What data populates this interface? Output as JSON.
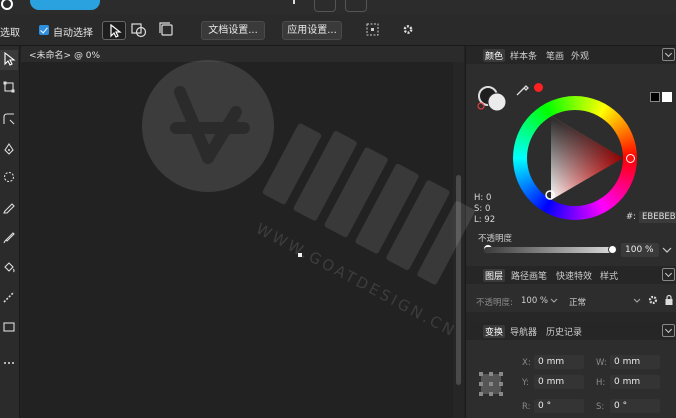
{
  "toolbar": {
    "select_label": "选取",
    "auto_select_label": "自动选择",
    "auto_select_checked": true,
    "doc_settings_label": "文档设置...",
    "app_settings_label": "应用设置..."
  },
  "document": {
    "tab_title": "<未命名> @ 0%"
  },
  "color_panel": {
    "tabs": [
      "颜色",
      "样本条",
      "笔画",
      "外观"
    ],
    "active_tab": "颜色",
    "h_label": "H: 0",
    "s_label": "S: 0",
    "l_label": "L: 92",
    "hex_prefix": "#:",
    "hex_value": "EBEBEB",
    "opacity_label": "不透明度",
    "opacity_value": "100 %",
    "opacity_fraction": 1.0,
    "hue_marker_color": "#ff2020"
  },
  "layers_panel": {
    "tabs": [
      "图层",
      "路径画笔",
      "快速特效",
      "样式"
    ],
    "active_tab": "图层",
    "opacity_label": "不透明度:",
    "opacity_value": "100 %",
    "blend_mode": "正常"
  },
  "transform_panel": {
    "tabs": [
      "变换",
      "导航器",
      "历史记录"
    ],
    "active_tab": "变换",
    "x_label": "X:",
    "x_value": "0 mm",
    "y_label": "Y:",
    "y_value": "0 mm",
    "w_label": "W:",
    "w_value": "0 mm",
    "h_label": "H:",
    "h_value": "0 mm",
    "r_label": "R:",
    "r_value": "0 °",
    "s_label": "S:",
    "s_value": "0 °"
  },
  "watermark": {
    "brand_text": "WWW.GOATDESIGN.CN"
  },
  "colors": {
    "accent": "#2aa2e0",
    "canvas": "#222222",
    "panel": "#2d2d2d"
  }
}
